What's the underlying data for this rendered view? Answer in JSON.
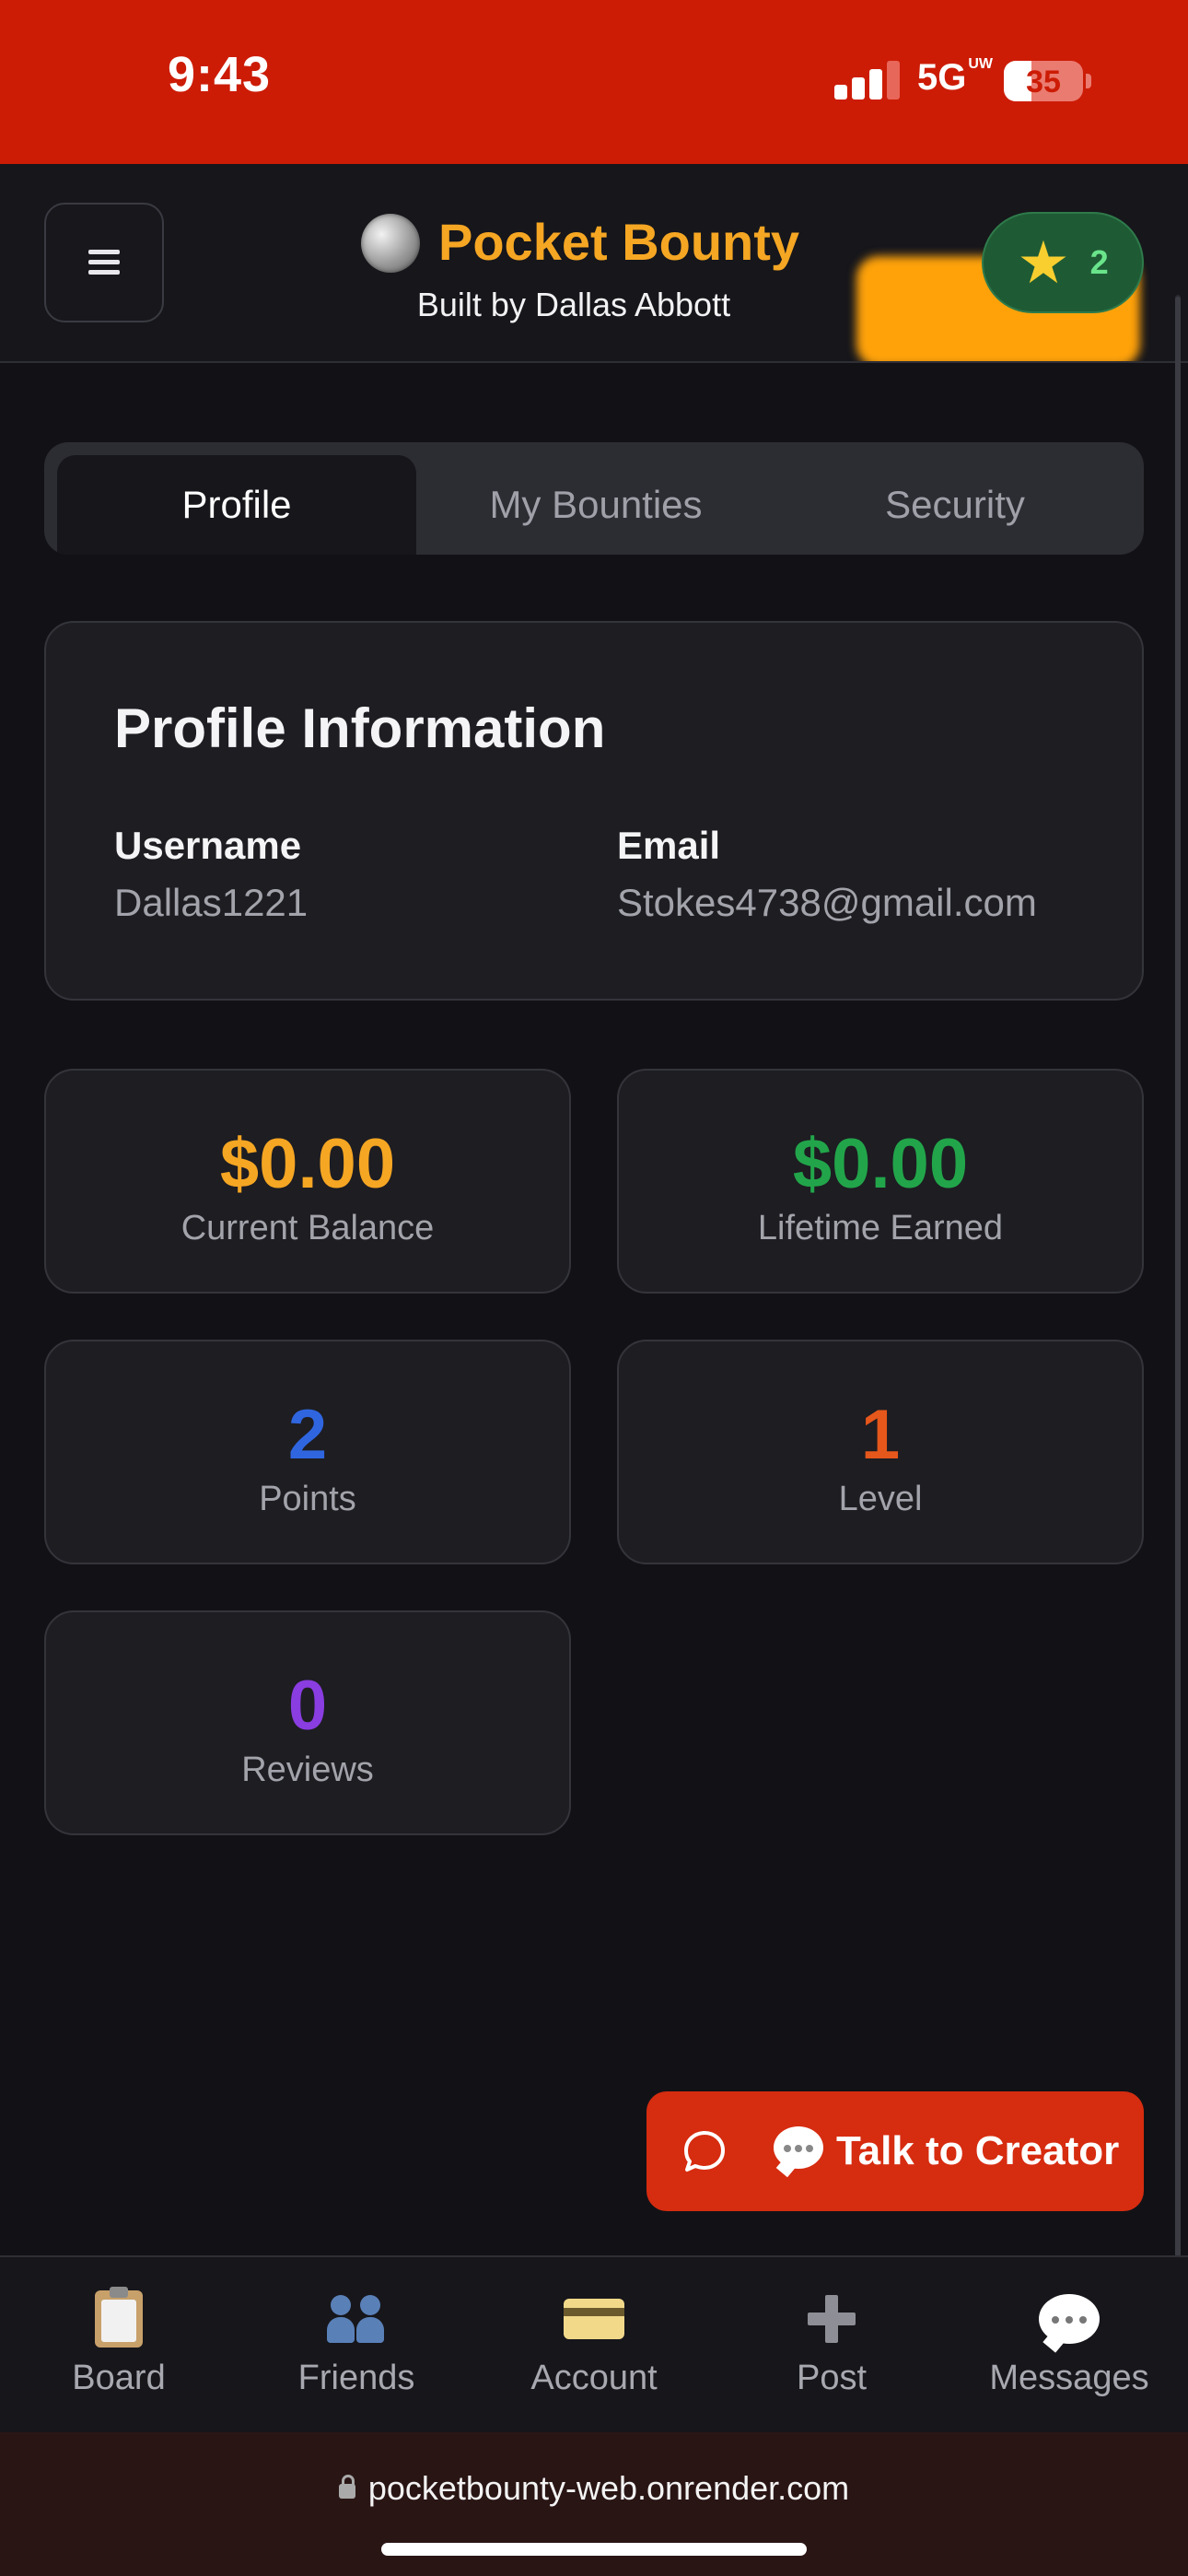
{
  "status_bar": {
    "time": "9:43",
    "network": "5G",
    "network_suffix": "UW",
    "battery": "35"
  },
  "header": {
    "title": "Pocket Bounty",
    "subtitle": "Built by Dallas Abbott",
    "points_badge": "2",
    "logo_icon": "coin-icon"
  },
  "tabs": [
    {
      "label": "Profile",
      "active": true
    },
    {
      "label": "My Bounties",
      "active": false
    },
    {
      "label": "Security",
      "active": false
    }
  ],
  "profile": {
    "title": "Profile Information",
    "username_label": "Username",
    "username": "Dallas1221",
    "email_label": "Email",
    "email": "Stokes4738@gmail.com"
  },
  "stats": [
    {
      "value": "$0.00",
      "label": "Current Balance",
      "color": "#f5a623"
    },
    {
      "value": "$0.00",
      "label": "Lifetime Earned",
      "color": "#22a54a"
    },
    {
      "value": "2",
      "label": "Points",
      "color": "#2f66e0"
    },
    {
      "value": "1",
      "label": "Level",
      "color": "#e6571b"
    },
    {
      "value": "0",
      "label": "Reviews",
      "color": "#8a3de0"
    }
  ],
  "talk_button": {
    "label": "💬 Talk to Creator",
    "text": "Talk to Creator"
  },
  "bottom_nav": [
    {
      "label": "Board",
      "icon": "clipboard-icon"
    },
    {
      "label": "Friends",
      "icon": "friends-icon"
    },
    {
      "label": "Account",
      "icon": "credit-card-icon"
    },
    {
      "label": "Post",
      "icon": "plus-icon"
    },
    {
      "label": "Messages",
      "icon": "speech-bubble-icon"
    }
  ],
  "browser": {
    "url": "pocketbounty-web.onrender.com"
  },
  "colors": {
    "status_bar": "#cc1c06",
    "brand": "#f5a623",
    "background": "#121216",
    "card": "#1d1d22",
    "talk_button": "#d62c10"
  }
}
